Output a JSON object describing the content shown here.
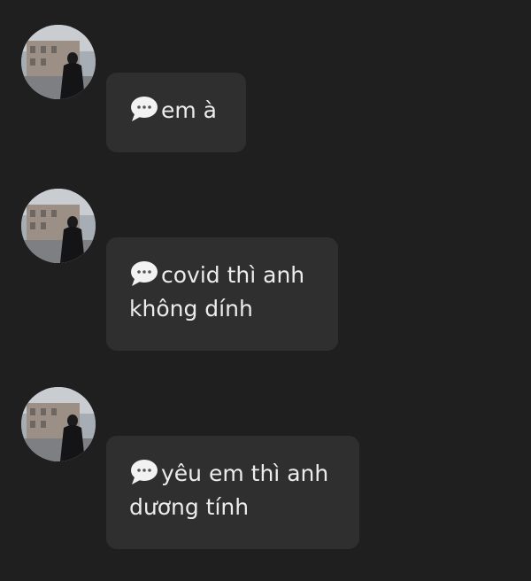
{
  "messages": [
    {
      "text": "em à",
      "icon": "speech-bubble-icon"
    },
    {
      "text": "covid thì anh không dính",
      "icon": "speech-bubble-icon"
    },
    {
      "text": "yêu em thì anh dương tính",
      "icon": "speech-bubble-icon"
    }
  ],
  "colors": {
    "background": "#1f1f1f",
    "bubble": "#2f2f2f",
    "text": "#ececec"
  }
}
